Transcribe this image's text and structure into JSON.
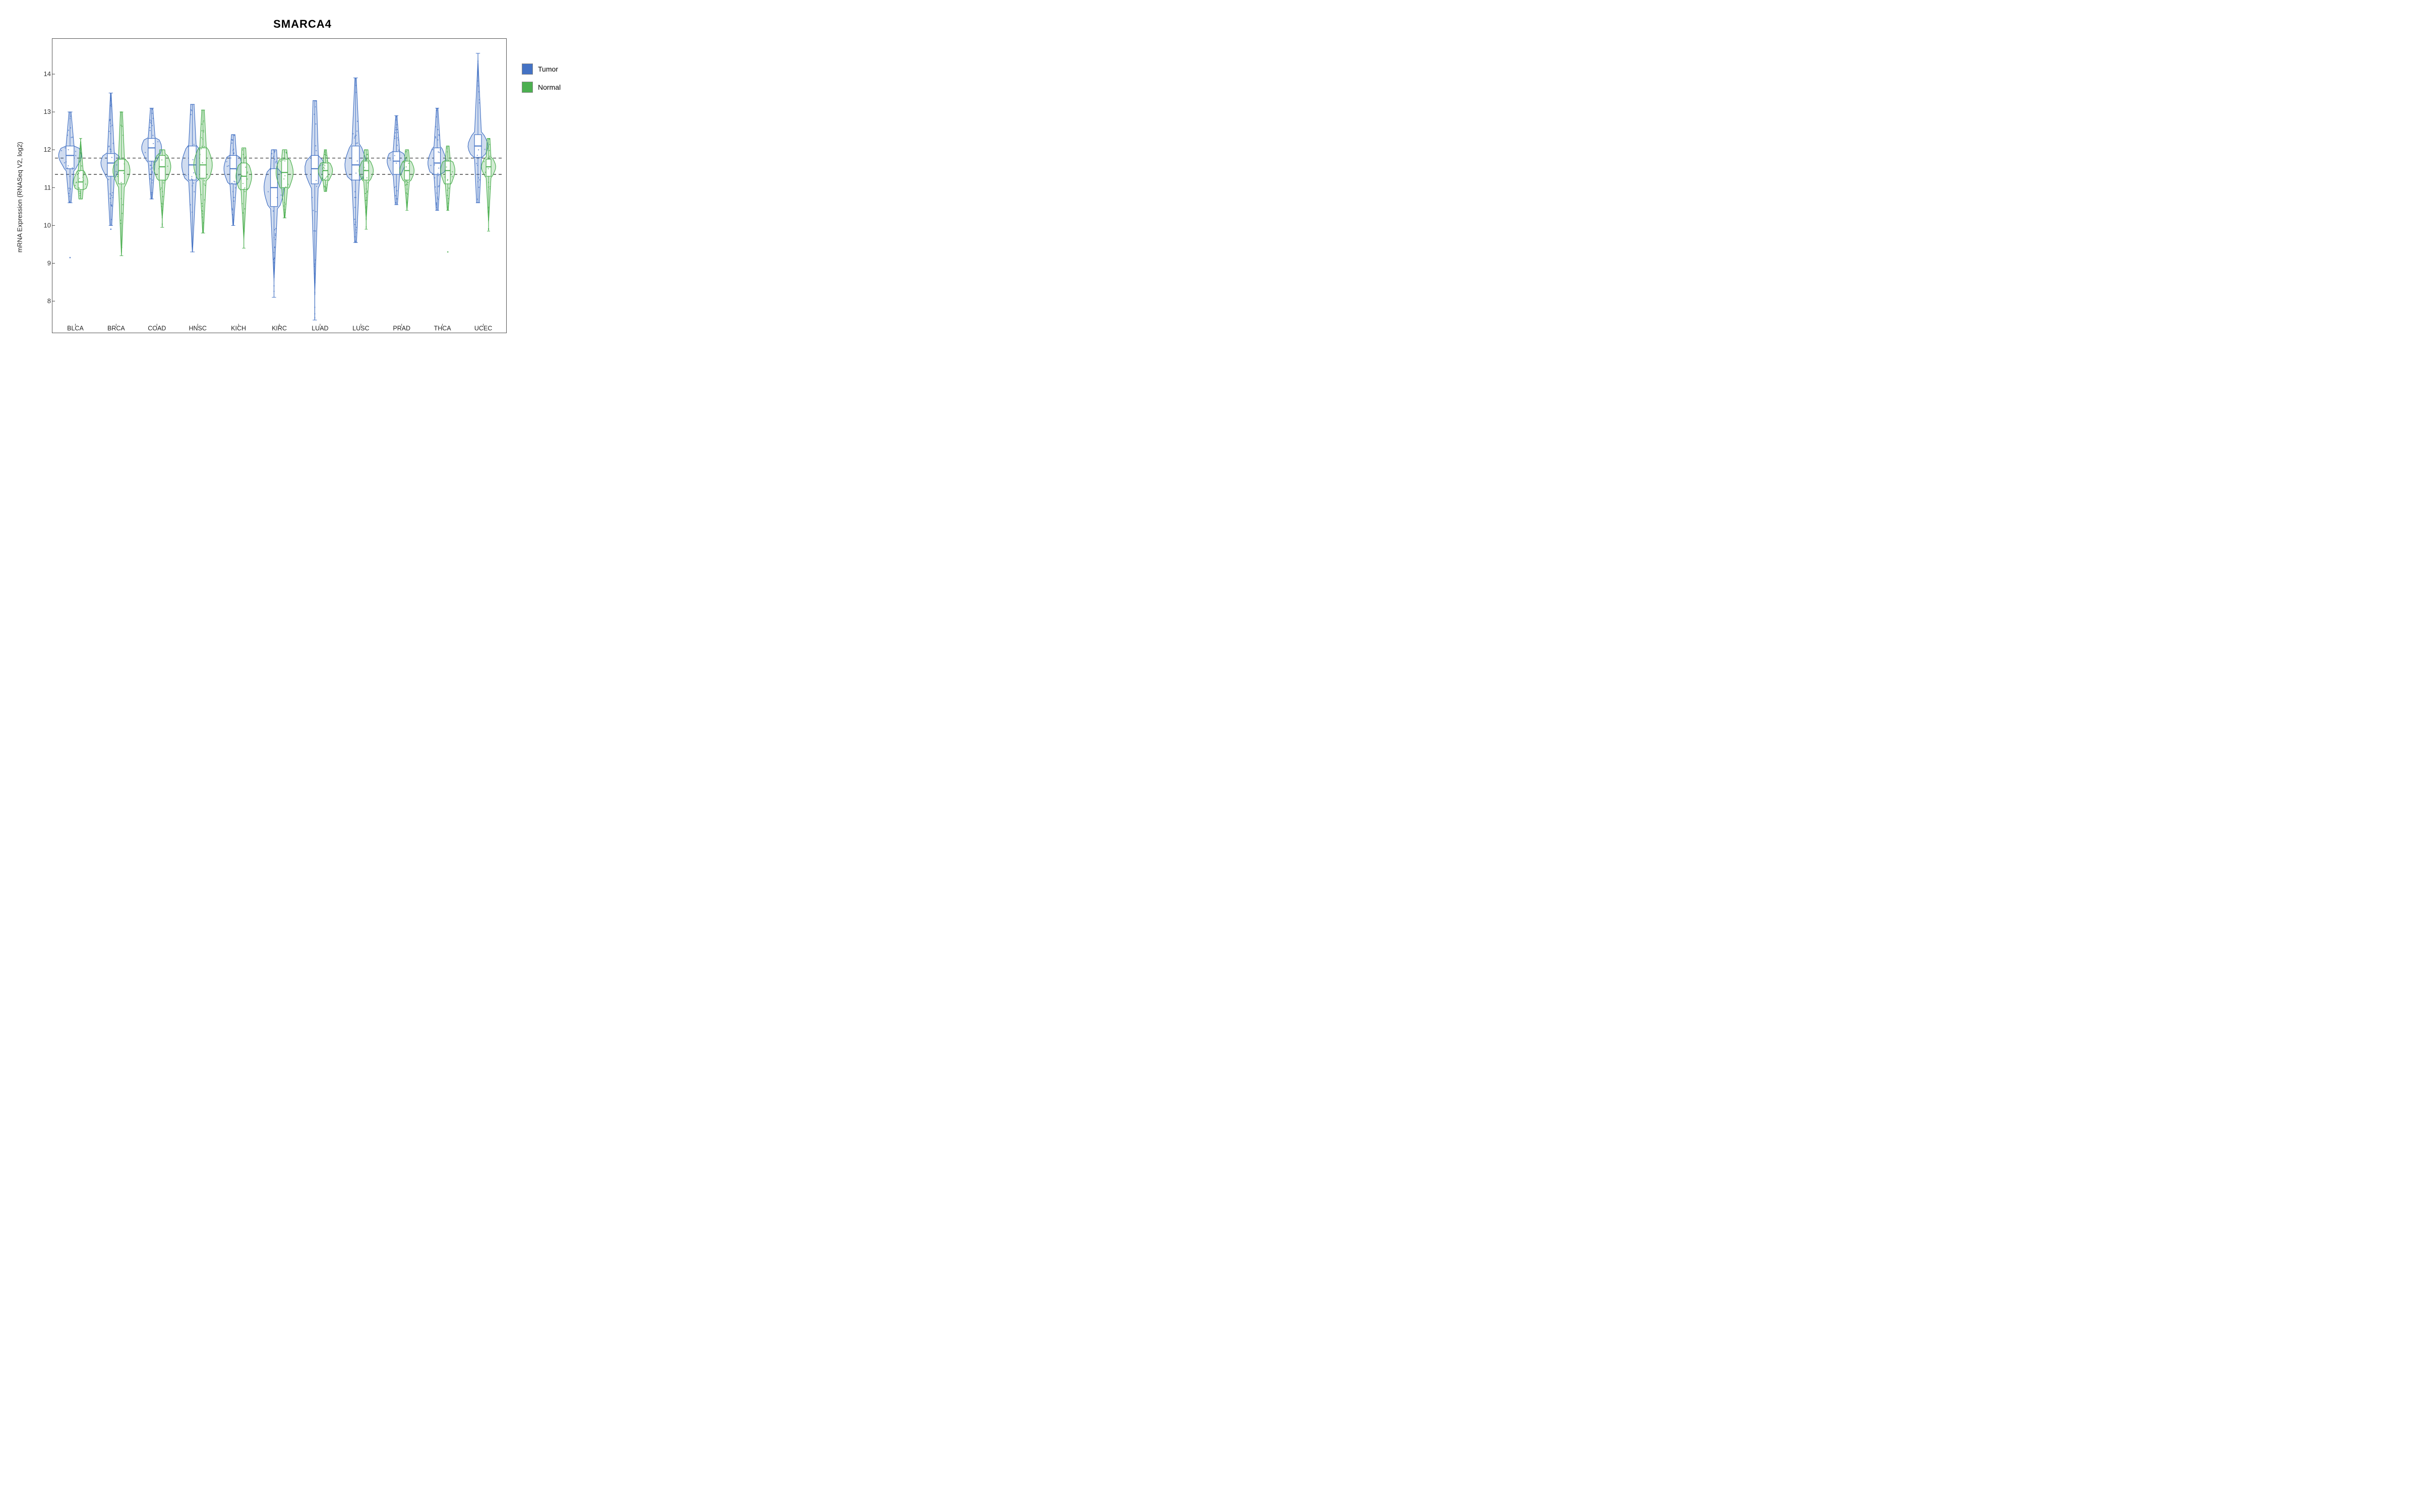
{
  "title": "SMARCA4",
  "yAxisLabel": "mRNA Expression (RNASeq V2, log2)",
  "xAxisLabels": [
    "BLCA",
    "BRCA",
    "COAD",
    "HNSC",
    "KICH",
    "KIRC",
    "LUAD",
    "LUSC",
    "PRAD",
    "THCA",
    "UCEC"
  ],
  "yTicks": [
    8,
    9,
    10,
    11,
    12,
    13,
    14
  ],
  "yMin": 7.4,
  "yMax": 14.7,
  "dottedLines": [
    11.35,
    11.78
  ],
  "legend": {
    "items": [
      {
        "label": "Tumor",
        "color": "#4472C4"
      },
      {
        "label": "Normal",
        "color": "#4CAF50"
      }
    ]
  },
  "violins": [
    {
      "cancer": "BLCA",
      "tumor": {
        "center": 11.85,
        "q1": 11.5,
        "q3": 12.1,
        "min": 10.6,
        "max": 13.0,
        "width": 0.8,
        "outliers": [
          9.15
        ]
      },
      "normal": {
        "center": 11.15,
        "q1": 10.95,
        "q3": 11.45,
        "min": 10.7,
        "max": 12.3,
        "width": 0.5,
        "outliers": []
      }
    },
    {
      "cancer": "BRCA",
      "tumor": {
        "center": 11.65,
        "q1": 11.3,
        "q3": 11.9,
        "min": 10.0,
        "max": 13.5,
        "width": 0.7,
        "outliers": [
          9.9
        ]
      },
      "normal": {
        "center": 11.45,
        "q1": 11.1,
        "q3": 11.75,
        "min": 9.2,
        "max": 13.0,
        "width": 0.6,
        "outliers": []
      }
    },
    {
      "cancer": "COAD",
      "tumor": {
        "center": 12.05,
        "q1": 11.7,
        "q3": 12.3,
        "min": 10.7,
        "max": 13.1,
        "width": 0.7,
        "outliers": []
      },
      "normal": {
        "center": 11.55,
        "q1": 11.2,
        "q3": 11.85,
        "min": 9.95,
        "max": 12.0,
        "width": 0.6,
        "outliers": []
      }
    },
    {
      "cancer": "HNSC",
      "tumor": {
        "center": 11.6,
        "q1": 11.2,
        "q3": 12.1,
        "min": 9.3,
        "max": 13.2,
        "width": 0.75,
        "outliers": []
      },
      "normal": {
        "center": 11.6,
        "q1": 11.25,
        "q3": 12.05,
        "min": 9.8,
        "max": 13.05,
        "width": 0.65,
        "outliers": []
      }
    },
    {
      "cancer": "KICH",
      "tumor": {
        "center": 11.5,
        "q1": 11.1,
        "q3": 11.85,
        "min": 10.0,
        "max": 12.4,
        "width": 0.65,
        "outliers": []
      },
      "normal": {
        "center": 11.3,
        "q1": 10.95,
        "q3": 11.65,
        "min": 9.4,
        "max": 12.05,
        "width": 0.55,
        "outliers": []
      }
    },
    {
      "cancer": "KIRC",
      "tumor": {
        "center": 11.0,
        "q1": 10.5,
        "q3": 11.5,
        "min": 8.1,
        "max": 12.0,
        "width": 0.7,
        "outliers": []
      },
      "normal": {
        "center": 11.4,
        "q1": 11.0,
        "q3": 11.75,
        "min": 10.2,
        "max": 12.0,
        "width": 0.6,
        "outliers": []
      }
    },
    {
      "cancer": "LUAD",
      "tumor": {
        "center": 11.5,
        "q1": 11.1,
        "q3": 11.85,
        "min": 7.5,
        "max": 13.3,
        "width": 0.7,
        "outliers": []
      },
      "normal": {
        "center": 11.45,
        "q1": 11.2,
        "q3": 11.65,
        "min": 10.9,
        "max": 12.0,
        "width": 0.5,
        "outliers": []
      }
    },
    {
      "cancer": "LUSC",
      "tumor": {
        "center": 11.6,
        "q1": 11.2,
        "q3": 12.1,
        "min": 9.55,
        "max": 13.9,
        "width": 0.75,
        "outliers": []
      },
      "normal": {
        "center": 11.45,
        "q1": 11.2,
        "q3": 11.7,
        "min": 9.9,
        "max": 12.0,
        "width": 0.5,
        "outliers": []
      }
    },
    {
      "cancer": "PRAD",
      "tumor": {
        "center": 11.7,
        "q1": 11.35,
        "q3": 11.95,
        "min": 10.55,
        "max": 12.9,
        "width": 0.65,
        "outliers": []
      },
      "normal": {
        "center": 11.45,
        "q1": 11.2,
        "q3": 11.7,
        "min": 10.4,
        "max": 12.0,
        "width": 0.5,
        "outliers": []
      }
    },
    {
      "cancer": "THCA",
      "tumor": {
        "center": 11.65,
        "q1": 11.35,
        "q3": 12.05,
        "min": 10.4,
        "max": 13.1,
        "width": 0.65,
        "outliers": []
      },
      "normal": {
        "center": 11.45,
        "q1": 11.1,
        "q3": 11.7,
        "min": 10.4,
        "max": 12.1,
        "width": 0.5,
        "outliers": [
          9.3
        ]
      }
    },
    {
      "cancer": "UCEC",
      "tumor": {
        "center": 12.1,
        "q1": 11.8,
        "q3": 12.4,
        "min": 10.6,
        "max": 14.55,
        "width": 0.7,
        "outliers": []
      },
      "normal": {
        "center": 11.55,
        "q1": 11.3,
        "q3": 11.75,
        "min": 9.85,
        "max": 12.3,
        "width": 0.5,
        "outliers": []
      }
    }
  ]
}
